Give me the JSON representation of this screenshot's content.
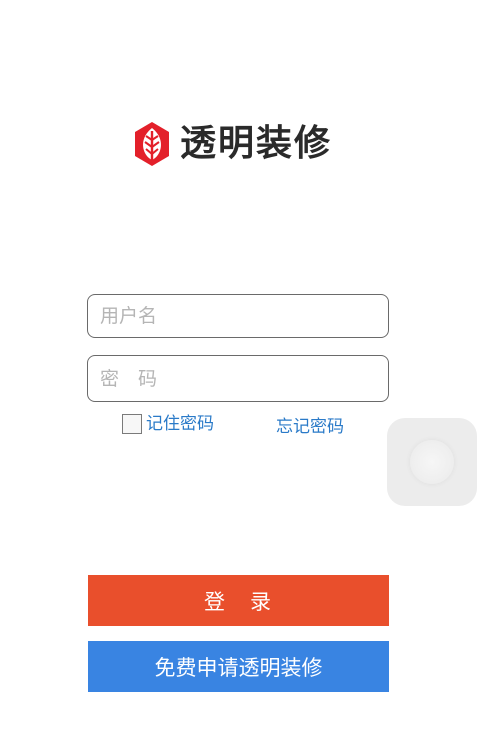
{
  "brand": {
    "name": "透明装修",
    "logo_color": "#e3202a"
  },
  "login_form": {
    "username_placeholder": "用户名",
    "password_placeholder": "密　码",
    "remember_label": "记住密码",
    "remember_checked": false,
    "forgot_label": "忘记密码"
  },
  "buttons": {
    "login_label": "登　录",
    "apply_label": "免费申请透明装修"
  },
  "colors": {
    "login_button": "#e94f2c",
    "apply_button": "#3984e2",
    "link": "#2a7ac8"
  }
}
